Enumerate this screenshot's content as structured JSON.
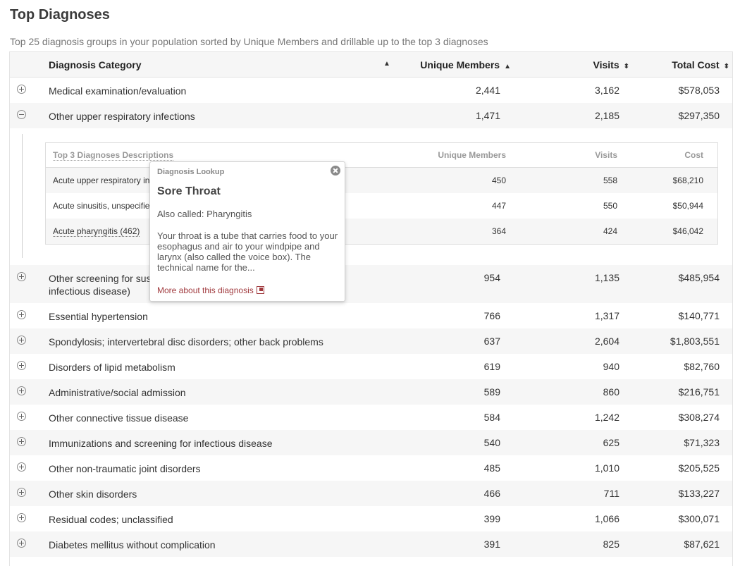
{
  "page": {
    "title": "Top Diagnoses",
    "subtitle": "Top 25 diagnosis groups in your population sorted by Unique Members and drillable up to the top 3 diagnoses"
  },
  "table": {
    "columns": {
      "category": "Diagnosis Category",
      "unique": "Unique Members",
      "visits": "Visits",
      "cost": "Total Cost"
    },
    "sort_icons": {
      "unsorted": "sort-both-icon",
      "ascending": "sort-up-icon"
    },
    "rows": [
      {
        "label": "Medical examination/evaluation",
        "unique": "2,441",
        "visits": "3,162",
        "cost": "$578,053",
        "expanded": false
      },
      {
        "label": "Other upper respiratory infections",
        "unique": "1,471",
        "visits": "2,185",
        "cost": "$297,350",
        "expanded": true
      },
      {
        "label": "Other screening for suspected conditions (not mental disorders or infectious disease)",
        "label_line1": "Other screening for suspected conditions (not mental disorders or",
        "label_line2": "infectious disease)",
        "unique": "954",
        "visits": "1,135",
        "cost": "$485,954",
        "expanded": false
      },
      {
        "label": "Essential hypertension",
        "unique": "766",
        "visits": "1,317",
        "cost": "$140,771",
        "expanded": false
      },
      {
        "label": "Spondylosis; intervertebral disc disorders; other back problems",
        "unique": "637",
        "visits": "2,604",
        "cost": "$1,803,551",
        "expanded": false
      },
      {
        "label": "Disorders of lipid metabolism",
        "unique": "619",
        "visits": "940",
        "cost": "$82,760",
        "expanded": false
      },
      {
        "label": "Administrative/social admission",
        "unique": "589",
        "visits": "860",
        "cost": "$216,751",
        "expanded": false
      },
      {
        "label": "Other connective tissue disease",
        "unique": "584",
        "visits": "1,242",
        "cost": "$308,274",
        "expanded": false
      },
      {
        "label": "Immunizations and screening for infectious disease",
        "unique": "540",
        "visits": "625",
        "cost": "$71,323",
        "expanded": false
      },
      {
        "label": "Other non-traumatic joint disorders",
        "unique": "485",
        "visits": "1,010",
        "cost": "$205,525",
        "expanded": false
      },
      {
        "label": "Other skin disorders",
        "unique": "466",
        "visits": "711",
        "cost": "$133,227",
        "expanded": false
      },
      {
        "label": "Residual codes; unclassified",
        "unique": "399",
        "visits": "1,066",
        "cost": "$300,071",
        "expanded": false
      },
      {
        "label": "Diabetes mellitus without complication",
        "unique": "391",
        "visits": "825",
        "cost": "$87,621",
        "expanded": false
      }
    ]
  },
  "subtable": {
    "columns": {
      "description": "Top 3 Diagnoses Descriptions",
      "unique": "Unique Members",
      "visits": "Visits",
      "cost": "Cost"
    },
    "rows": [
      {
        "description": "Acute upper respiratory infection, unspecified (450)",
        "unique": "450",
        "visits": "558",
        "cost": "$68,210"
      },
      {
        "description": "Acute sinusitis, unspecified (447)",
        "unique": "447",
        "visits": "550",
        "cost": "$50,944"
      },
      {
        "description": "Acute pharyngitis (462)",
        "unique": "364",
        "visits": "424",
        "cost": "$46,042"
      }
    ]
  },
  "popover": {
    "kicker": "Diagnosis Lookup",
    "title": "Sore Throat",
    "also_called": "Also called: Pharyngitis",
    "body": "Your throat is a tube that carries food to your esophagus and air to your windpipe and larynx (also called the voice box). The technical name for the...",
    "link": "More about this diagnosis",
    "close_icon": "close-icon",
    "link_icon": "external-link-icon"
  },
  "colors": {
    "row_shade": "#f6f6f6",
    "border": "#e3e3e3",
    "link": "#a0393d"
  }
}
